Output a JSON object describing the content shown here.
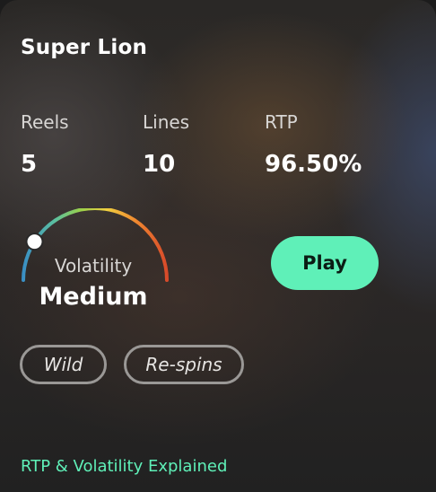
{
  "game": {
    "title": "Super Lion"
  },
  "stats": {
    "reels": {
      "label": "Reels",
      "value": "5"
    },
    "lines": {
      "label": "Lines",
      "value": "10"
    },
    "rtp": {
      "label": "RTP",
      "value": "96.50%"
    }
  },
  "volatility": {
    "label": "Volatility",
    "value": "Medium",
    "gauge_level": 0.18,
    "gauge_colors": [
      "#3a8fc4",
      "#5bc0a0",
      "#9ad04a",
      "#f0d040",
      "#f08a30",
      "#d84a2a"
    ]
  },
  "actions": {
    "play_label": "Play"
  },
  "tags": [
    "Wild",
    "Re-spins"
  ],
  "footer": {
    "link_label": "RTP & Volatility Explained"
  },
  "colors": {
    "accent": "#5ff0b8"
  }
}
